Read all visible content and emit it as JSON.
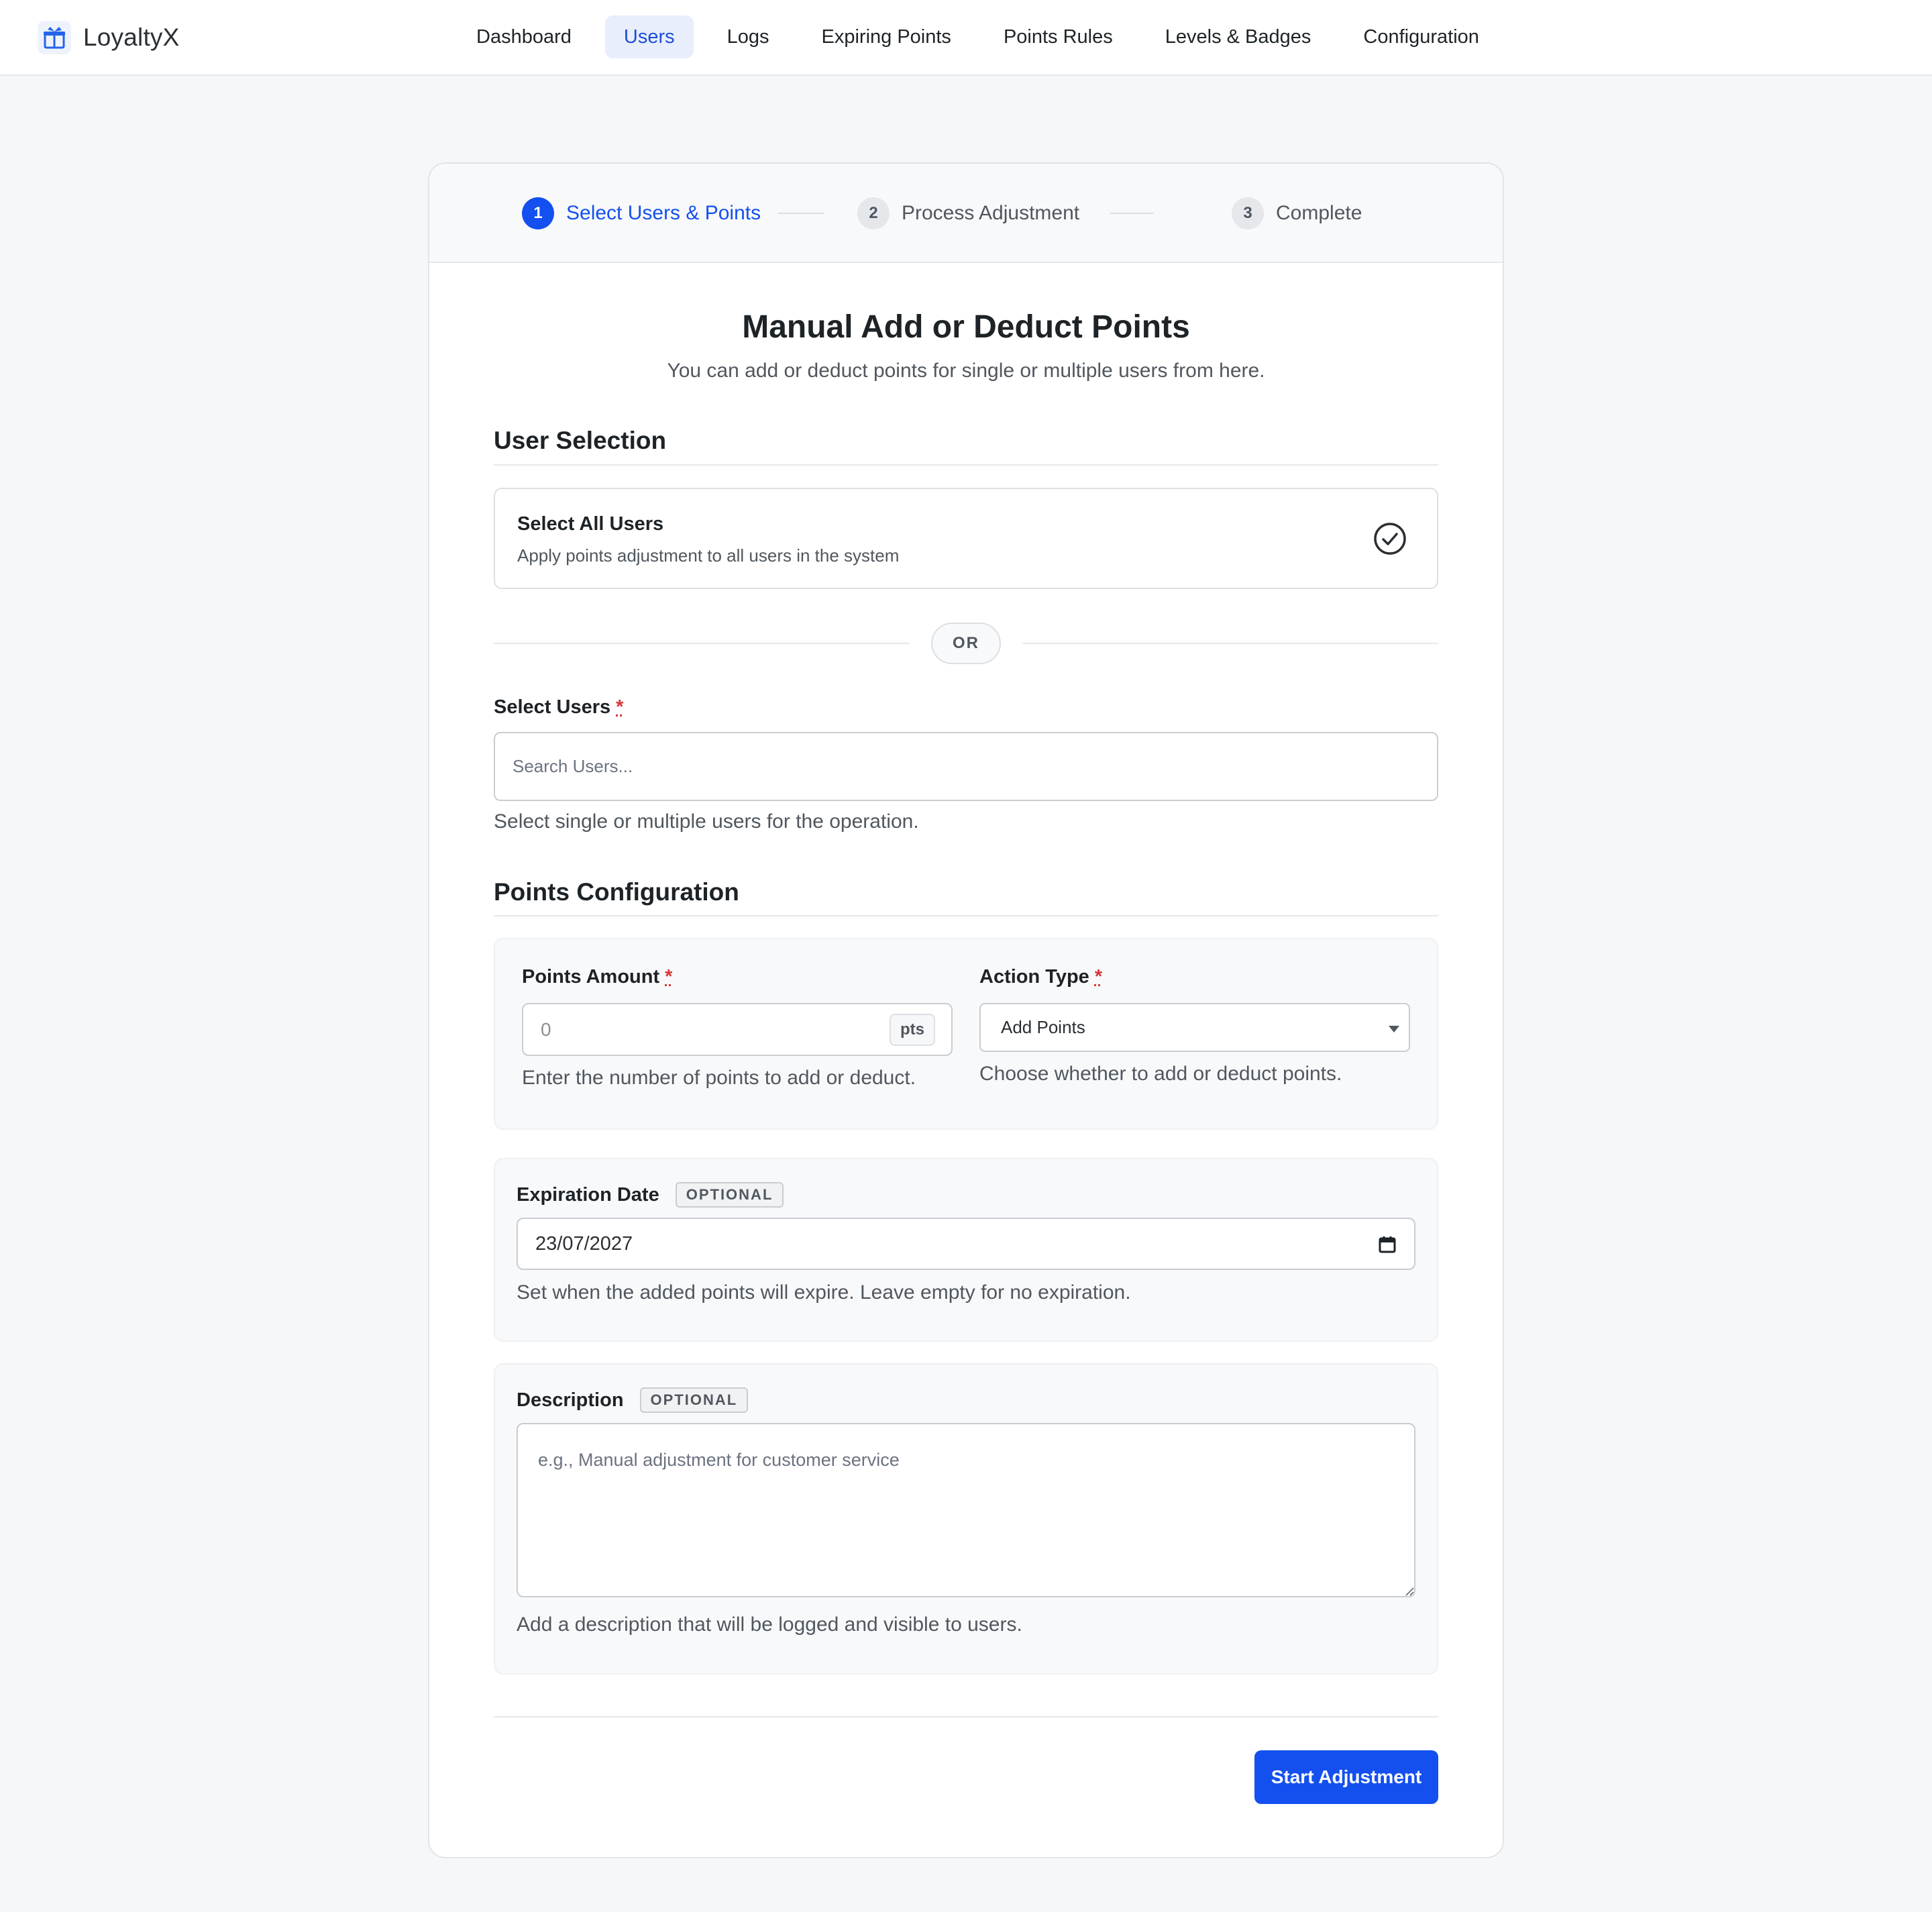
{
  "app": {
    "name": "LoyaltyX",
    "icon": "gift-icon"
  },
  "nav": {
    "items": [
      {
        "label": "Dashboard",
        "active": false
      },
      {
        "label": "Users",
        "active": true
      },
      {
        "label": "Logs",
        "active": false
      },
      {
        "label": "Expiring Points",
        "active": false
      },
      {
        "label": "Points Rules",
        "active": false
      },
      {
        "label": "Levels & Badges",
        "active": false
      },
      {
        "label": "Configuration",
        "active": false
      }
    ]
  },
  "stepper": {
    "steps": [
      {
        "number": "1",
        "label": "Select Users & Points",
        "active": true
      },
      {
        "number": "2",
        "label": "Process Adjustment",
        "active": false
      },
      {
        "number": "3",
        "label": "Complete",
        "active": false
      }
    ]
  },
  "form": {
    "title": "Manual Add or Deduct Points",
    "subtitle": "You can add or deduct points for single or multiple users from here.",
    "user_selection": {
      "section_title": "User Selection",
      "select_all_title": "Select All Users",
      "select_all_desc": "Apply points adjustment to all users in the system",
      "or_label": "OR",
      "select_users_label": "Select Users",
      "required_mark": "*",
      "search_placeholder": "Search Users...",
      "search_value": "",
      "help": "Select single or multiple users for the operation."
    },
    "points_config": {
      "section_title": "Points Configuration",
      "points_amount_label": "Points Amount",
      "points_amount_placeholder": "0",
      "points_unit": "pts",
      "points_help": "Enter the number of points to add or deduct.",
      "action_type_label": "Action Type",
      "action_type_value": "Add Points",
      "action_help": "Choose whether to add or deduct points.",
      "expiration_label": "Expiration Date",
      "optional_tag": "OPTIONAL",
      "expiration_value": "23/07/2027",
      "expiration_help": "Set when the added points will expire. Leave empty for no expiration.",
      "description_label": "Description",
      "description_placeholder": "e.g., Manual adjustment for customer service",
      "description_help": "Add a description that will be logged and visible to users."
    },
    "submit_label": "Start Adjustment"
  },
  "colors": {
    "accent": "#1450ef",
    "required": "#d63638",
    "nav_active_bg": "#e8eefb"
  }
}
